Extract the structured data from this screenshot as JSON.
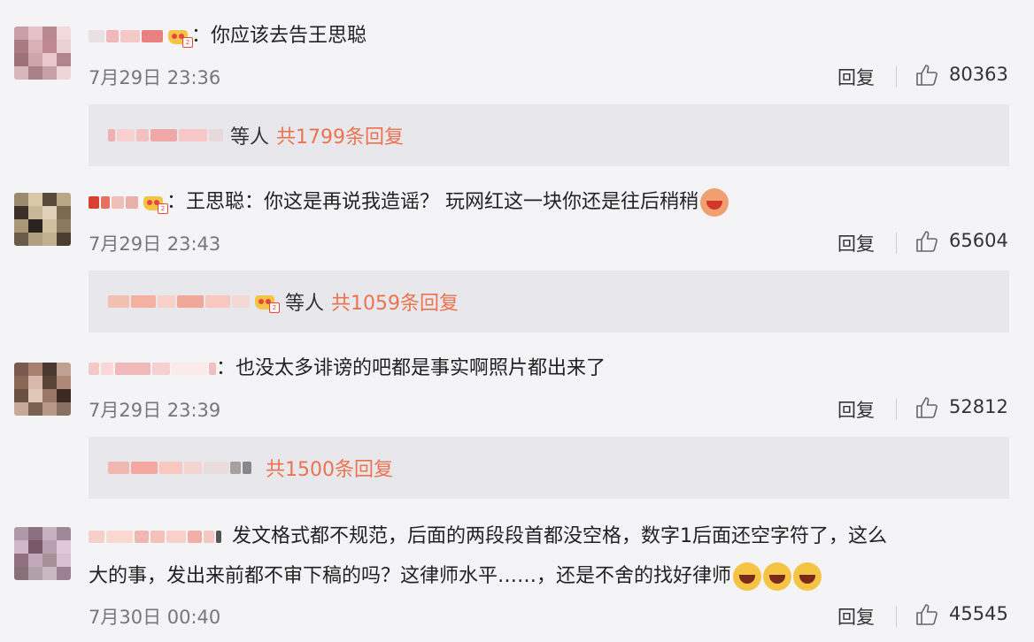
{
  "comments": [
    {
      "text": "：你应该去告王思聪",
      "time": "7月29日 23:36",
      "reply_label": "回复",
      "likes": "80363",
      "thread": {
        "etc": "等人",
        "total": "共1799条回复"
      },
      "avatar_colors": [
        "#c9a0a8",
        "#e6c2c8",
        "#b88a90",
        "#f1d9dc",
        "#a87a82",
        "#d9b0b6",
        "#c08890",
        "#ead0d4",
        "#9d6f76",
        "#cfa5ac",
        "#e8c8cd",
        "#b0868c",
        "#d7b7bc",
        "#a98188",
        "#c6a1a7",
        "#ecd6da"
      ]
    },
    {
      "text": "：王思聪：你这是再说我造谣？ 玩网红这一块你还是往后稍稍",
      "time": "7月29日 23:43",
      "reply_label": "回复",
      "likes": "65604",
      "thread": {
        "etc": "等人",
        "total": "共1059条回复"
      },
      "avatar_colors": [
        "#9a8a70",
        "#d8c8a8",
        "#5a4a3a",
        "#b8a888",
        "#3a3028",
        "#c8b898",
        "#e0d0b8",
        "#7a6a50",
        "#a89878",
        "#2a2420",
        "#d0c0a0",
        "#8a7a60",
        "#6a5a48",
        "#b0a080",
        "#c0b090",
        "#4a3e30"
      ]
    },
    {
      "text": "：也没太多诽谤的吧都是事实啊照片都出来了",
      "time": "7月29日 23:39",
      "reply_label": "回复",
      "likes": "52812",
      "thread": {
        "etc": "",
        "total": "共1500条回复"
      },
      "avatar_colors": [
        "#7a5a50",
        "#a88070",
        "#4a3830",
        "#c0a090",
        "#8a6858",
        "#d8b8a8",
        "#5a4438",
        "#b08878",
        "#6a5040",
        "#e0c8b8",
        "#9a7868",
        "#3a2a22",
        "#c8a898",
        "#7a6050",
        "#b89888",
        "#8a7060"
      ]
    },
    {
      "text": "发文格式都不规范，后面的两段段首都没空格，数字1后面还空字符了，这么",
      "text2": "大的事，发出来前都不审下稿的吗？这律师水平……，还是不舍的找好律师",
      "time": "7月30日 00:40",
      "reply_label": "回复",
      "likes": "45545",
      "avatar_colors": [
        "#b098a8",
        "#8a7080",
        "#c8b0c0",
        "#a08898",
        "#d0b8c8",
        "#785868",
        "#b8a0b0",
        "#e0c8d8",
        "#907080",
        "#c0a8b8",
        "#a89098",
        "#d8c0d0",
        "#887078",
        "#b0a0a8",
        "#c8b8c0",
        "#9a8090"
      ]
    }
  ],
  "colors": {
    "accent": "#eb7350",
    "bg": "#f4f4f6",
    "thread_bg": "#e8e8ec"
  },
  "icons": [
    "crown-badge-icon",
    "thumbs-up-icon",
    "grin-emoji-icon",
    "laugh-cry-emoji-icon"
  ]
}
